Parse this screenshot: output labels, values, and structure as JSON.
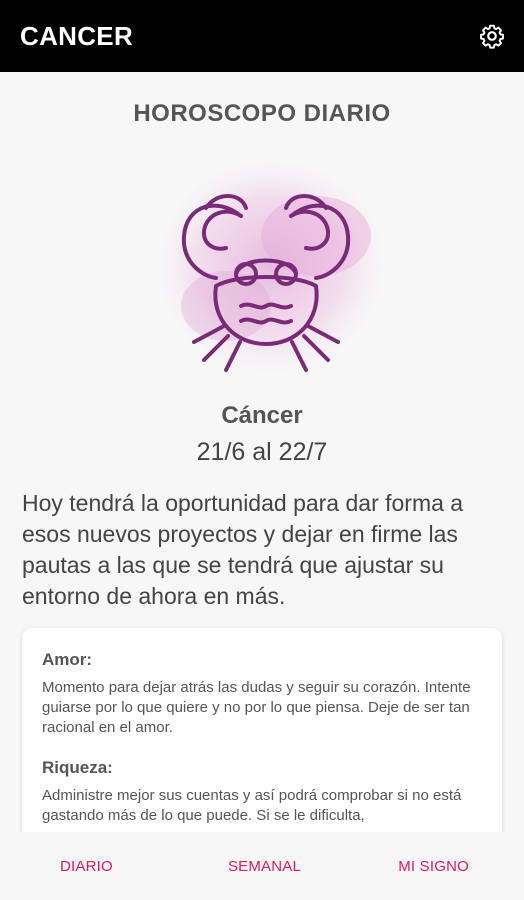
{
  "appbar": {
    "title": "CANCER",
    "settings_icon": "gear-icon"
  },
  "main": {
    "section_title": "HOROSCOPO DIARIO",
    "sign_image_icon": "cancer-crab-icon",
    "sign_name": "Cáncer",
    "sign_dates": "21/6 al 22/7",
    "horoscope_text": "Hoy tendrá la oportunidad para dar forma a esos nuevos proyectos y dejar en firme las pautas a las que se tendrá que ajustar su entorno de ahora en más.",
    "sections": [
      {
        "heading": "Amor:",
        "text": "Momento para dejar atrás las dudas y seguir su corazón. Intente guiarse por lo que quiere y no por lo que piensa. Deje de ser tan racional en el amor."
      },
      {
        "heading": "Riqueza:",
        "text": "Administre mejor sus cuentas y así podrá comprobar si no está gastando más de lo que puede. Si se le dificulta,"
      }
    ]
  },
  "bottom_nav": {
    "items": [
      {
        "label": "DIARIO"
      },
      {
        "label": "SEMANAL"
      },
      {
        "label": "MI SIGNO"
      }
    ]
  },
  "colors": {
    "appbar_bg": "#000000",
    "accent": "#d81b60",
    "background": "#f7f7f7"
  }
}
